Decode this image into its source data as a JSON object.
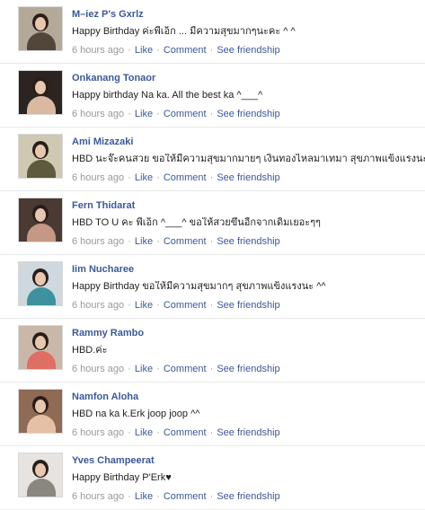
{
  "actions": {
    "like": "Like",
    "comment": "Comment",
    "see_friendship": "See friendship",
    "separator": " · "
  },
  "posts": [
    {
      "name": "M–iez P's Gxrlz",
      "message": "Happy Birthday ค่ะพี่เอ็ก ... มีความสุขมากๆนะคะ ^ ^",
      "time": "6 hours ago",
      "avatar_bg": "#b4a999",
      "avatar_fg": "#52453a"
    },
    {
      "name": "Onkanang Tonaor",
      "message": "Happy birthday Na ka. All the best ka ^___^",
      "time": "6 hours ago",
      "avatar_bg": "#2c2420",
      "avatar_fg": "#d9b9a1"
    },
    {
      "name": "Ami Mizazaki",
      "message": "HBD นะจ๊ะคนสวย ขอให้มีความสุขมากมายๆ เงินทองไหลมาเทมา สุขภาพแข็งแรงนะจ๊ะ",
      "time": "6 hours ago",
      "avatar_bg": "#cfc8b2",
      "avatar_fg": "#5d5a3d"
    },
    {
      "name": "Fern Thidarat",
      "message": "HBD TO U คะ พี่เอ็ก ^___^ ขอให้สวยขึ้นอีกจากเดิมเยอะๆๆ",
      "time": "6 hours ago",
      "avatar_bg": "#4a3a33",
      "avatar_fg": "#c49884"
    },
    {
      "name": "Iim Nucharee",
      "message": "Happy Birthday ขอให้มีความสุขมากๆ สุขภาพแข็งแรงนะ ^^",
      "time": "6 hours ago",
      "avatar_bg": "#cfd7df",
      "avatar_fg": "#3e92a0"
    },
    {
      "name": "Rammy Rambo",
      "message": "HBD.ค่ะ",
      "time": "6 hours ago",
      "avatar_bg": "#c9b8a9",
      "avatar_fg": "#e06f63"
    },
    {
      "name": "Namfon Aloha",
      "message": "HBD na ka k.Erk joop joop ^^",
      "time": "6 hours ago",
      "avatar_bg": "#8f6a55",
      "avatar_fg": "#e5c0a4"
    },
    {
      "name": "Yves Champeerat",
      "message": "Happy Birthday P'Erk♥",
      "time": "6 hours ago",
      "avatar_bg": "#e6e3e0",
      "avatar_fg": "#8a8680"
    }
  ]
}
